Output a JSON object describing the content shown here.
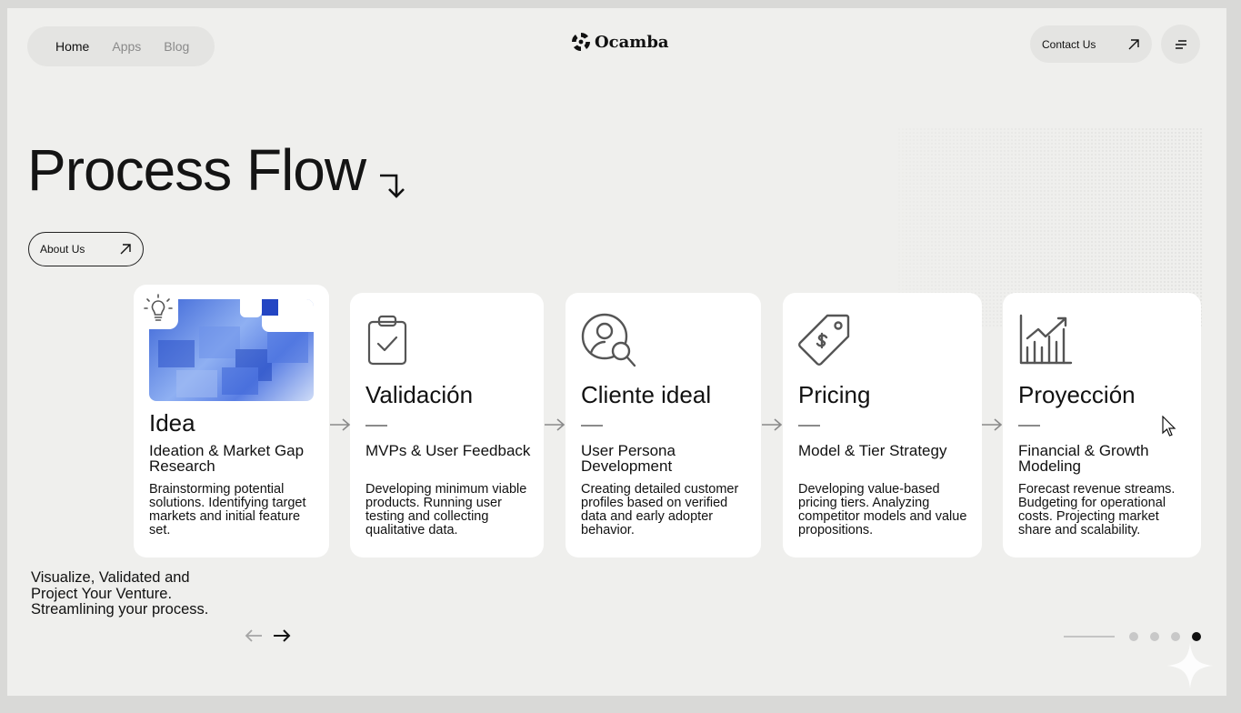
{
  "nav": {
    "items": [
      {
        "label": "Home",
        "active": true
      },
      {
        "label": "Apps",
        "active": false
      },
      {
        "label": "Blog",
        "active": false
      }
    ]
  },
  "brand": {
    "name": "Ocamba",
    "logo_icon": "ocamba-logo-icon"
  },
  "header": {
    "contact_label": "Contact Us",
    "contact_icon": "arrow-up-right-icon",
    "menu_icon": "menu-icon"
  },
  "hero": {
    "title": "Process Flow",
    "title_icon": "arrow-down-right-icon",
    "about_label": "About Us"
  },
  "cards": [
    {
      "title": "Idea",
      "subtitle": "Ideation & Market Gap Research",
      "description": "Brainstorming potential solutions. Identifying target markets and initial feature set.",
      "icon": "lightbulb-icon"
    },
    {
      "title": "Validación",
      "subtitle": "MVPs & User Feedback",
      "description": "Developing minimum viable products. Running user testing and collecting qualitative data.",
      "icon": "clipboard-check-icon"
    },
    {
      "title": "Cliente ideal",
      "subtitle": "User Persona Development",
      "description": "Creating detailed customer profiles based on verified data and early adopter behavior.",
      "icon": "user-search-icon"
    },
    {
      "title": "Pricing",
      "subtitle": "Model & Tier Strategy",
      "description": "Developing value-based pricing tiers. Analyzing competitor models and value propositions.",
      "icon": "price-tag-icon"
    },
    {
      "title": "Proyección",
      "subtitle": "Financial & Growth Modeling",
      "description": "Forecast revenue streams. Budgeting for operational costs. Projecting market share and scalability.",
      "icon": "growth-chart-icon"
    }
  ],
  "tagline": "Visualize, Validated and Project Your Venture. Streamlining your process.",
  "pagination": {
    "total": 4,
    "active_index": 3
  },
  "colors": {
    "background": "#efefed",
    "card": "#ffffff",
    "pill": "#e4e4e2",
    "accent_blue": "#3a63d6",
    "text": "#111111",
    "muted": "#8a8a8a"
  }
}
